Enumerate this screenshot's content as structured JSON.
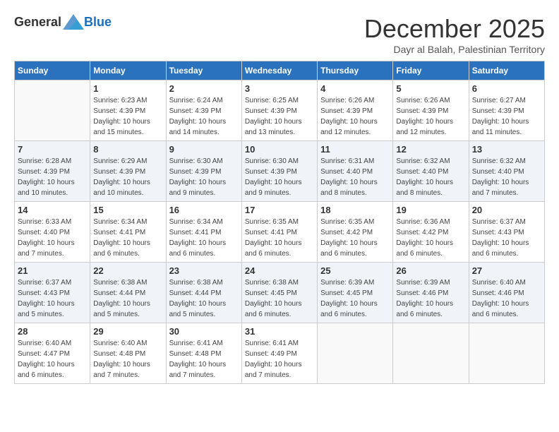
{
  "logo": {
    "general": "General",
    "blue": "Blue"
  },
  "title": "December 2025",
  "subtitle": "Dayr al Balah, Palestinian Territory",
  "days_of_week": [
    "Sunday",
    "Monday",
    "Tuesday",
    "Wednesday",
    "Thursday",
    "Friday",
    "Saturday"
  ],
  "weeks": [
    [
      {
        "day": "",
        "info": ""
      },
      {
        "day": "1",
        "info": "Sunrise: 6:23 AM\nSunset: 4:39 PM\nDaylight: 10 hours\nand 15 minutes."
      },
      {
        "day": "2",
        "info": "Sunrise: 6:24 AM\nSunset: 4:39 PM\nDaylight: 10 hours\nand 14 minutes."
      },
      {
        "day": "3",
        "info": "Sunrise: 6:25 AM\nSunset: 4:39 PM\nDaylight: 10 hours\nand 13 minutes."
      },
      {
        "day": "4",
        "info": "Sunrise: 6:26 AM\nSunset: 4:39 PM\nDaylight: 10 hours\nand 12 minutes."
      },
      {
        "day": "5",
        "info": "Sunrise: 6:26 AM\nSunset: 4:39 PM\nDaylight: 10 hours\nand 12 minutes."
      },
      {
        "day": "6",
        "info": "Sunrise: 6:27 AM\nSunset: 4:39 PM\nDaylight: 10 hours\nand 11 minutes."
      }
    ],
    [
      {
        "day": "7",
        "info": "Sunrise: 6:28 AM\nSunset: 4:39 PM\nDaylight: 10 hours\nand 10 minutes."
      },
      {
        "day": "8",
        "info": "Sunrise: 6:29 AM\nSunset: 4:39 PM\nDaylight: 10 hours\nand 10 minutes."
      },
      {
        "day": "9",
        "info": "Sunrise: 6:30 AM\nSunset: 4:39 PM\nDaylight: 10 hours\nand 9 minutes."
      },
      {
        "day": "10",
        "info": "Sunrise: 6:30 AM\nSunset: 4:39 PM\nDaylight: 10 hours\nand 9 minutes."
      },
      {
        "day": "11",
        "info": "Sunrise: 6:31 AM\nSunset: 4:40 PM\nDaylight: 10 hours\nand 8 minutes."
      },
      {
        "day": "12",
        "info": "Sunrise: 6:32 AM\nSunset: 4:40 PM\nDaylight: 10 hours\nand 8 minutes."
      },
      {
        "day": "13",
        "info": "Sunrise: 6:32 AM\nSunset: 4:40 PM\nDaylight: 10 hours\nand 7 minutes."
      }
    ],
    [
      {
        "day": "14",
        "info": "Sunrise: 6:33 AM\nSunset: 4:40 PM\nDaylight: 10 hours\nand 7 minutes."
      },
      {
        "day": "15",
        "info": "Sunrise: 6:34 AM\nSunset: 4:41 PM\nDaylight: 10 hours\nand 6 minutes."
      },
      {
        "day": "16",
        "info": "Sunrise: 6:34 AM\nSunset: 4:41 PM\nDaylight: 10 hours\nand 6 minutes."
      },
      {
        "day": "17",
        "info": "Sunrise: 6:35 AM\nSunset: 4:41 PM\nDaylight: 10 hours\nand 6 minutes."
      },
      {
        "day": "18",
        "info": "Sunrise: 6:35 AM\nSunset: 4:42 PM\nDaylight: 10 hours\nand 6 minutes."
      },
      {
        "day": "19",
        "info": "Sunrise: 6:36 AM\nSunset: 4:42 PM\nDaylight: 10 hours\nand 6 minutes."
      },
      {
        "day": "20",
        "info": "Sunrise: 6:37 AM\nSunset: 4:43 PM\nDaylight: 10 hours\nand 6 minutes."
      }
    ],
    [
      {
        "day": "21",
        "info": "Sunrise: 6:37 AM\nSunset: 4:43 PM\nDaylight: 10 hours\nand 5 minutes."
      },
      {
        "day": "22",
        "info": "Sunrise: 6:38 AM\nSunset: 4:44 PM\nDaylight: 10 hours\nand 5 minutes."
      },
      {
        "day": "23",
        "info": "Sunrise: 6:38 AM\nSunset: 4:44 PM\nDaylight: 10 hours\nand 5 minutes."
      },
      {
        "day": "24",
        "info": "Sunrise: 6:38 AM\nSunset: 4:45 PM\nDaylight: 10 hours\nand 6 minutes."
      },
      {
        "day": "25",
        "info": "Sunrise: 6:39 AM\nSunset: 4:45 PM\nDaylight: 10 hours\nand 6 minutes."
      },
      {
        "day": "26",
        "info": "Sunrise: 6:39 AM\nSunset: 4:46 PM\nDaylight: 10 hours\nand 6 minutes."
      },
      {
        "day": "27",
        "info": "Sunrise: 6:40 AM\nSunset: 4:46 PM\nDaylight: 10 hours\nand 6 minutes."
      }
    ],
    [
      {
        "day": "28",
        "info": "Sunrise: 6:40 AM\nSunset: 4:47 PM\nDaylight: 10 hours\nand 6 minutes."
      },
      {
        "day": "29",
        "info": "Sunrise: 6:40 AM\nSunset: 4:48 PM\nDaylight: 10 hours\nand 7 minutes."
      },
      {
        "day": "30",
        "info": "Sunrise: 6:41 AM\nSunset: 4:48 PM\nDaylight: 10 hours\nand 7 minutes."
      },
      {
        "day": "31",
        "info": "Sunrise: 6:41 AM\nSunset: 4:49 PM\nDaylight: 10 hours\nand 7 minutes."
      },
      {
        "day": "",
        "info": ""
      },
      {
        "day": "",
        "info": ""
      },
      {
        "day": "",
        "info": ""
      }
    ]
  ]
}
